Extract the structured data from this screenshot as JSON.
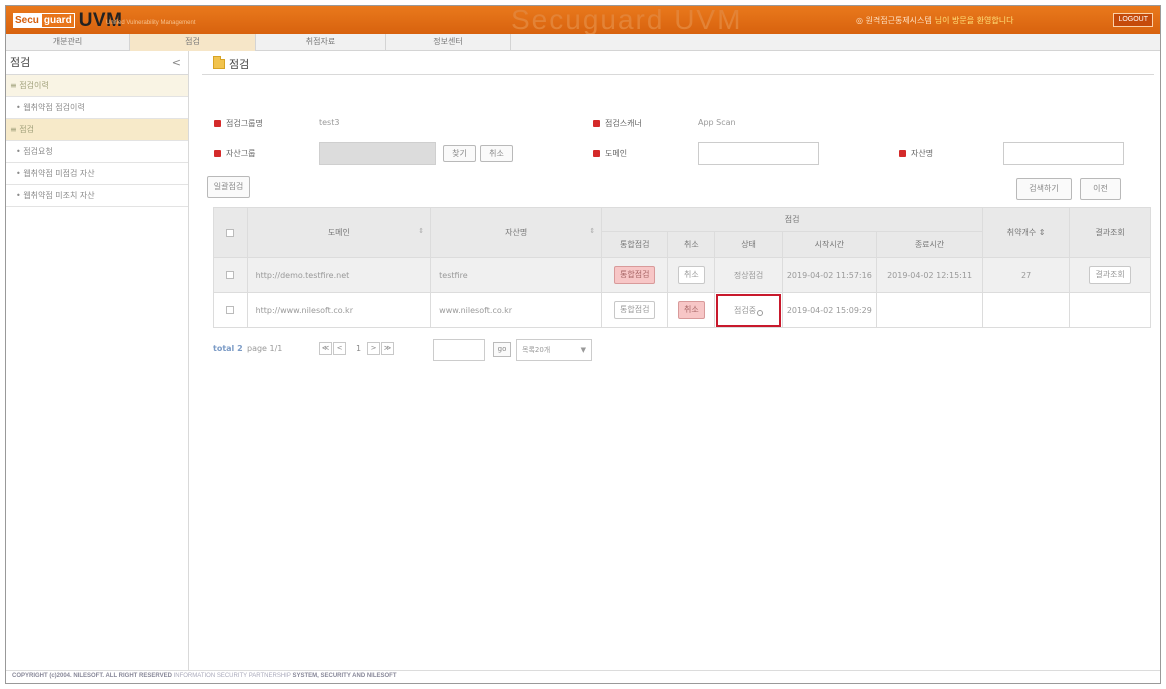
{
  "header": {
    "logo_secu": "Secu",
    "logo_guard": "guard",
    "logo_uvm": "UVM",
    "tagline": "Unified Vulnerability Management",
    "watermark": "Secuguard UVM",
    "notice_text": "◎ 원격접근통제시스템",
    "welcome_text": "님이 방문을 환영합니다",
    "logout_label": "LOGOUT",
    "colors": {
      "header_bg": "#e0691a",
      "nav_active": "#f6e6c8",
      "highlight": "#c8192c",
      "label_bullet": "#d42a2a"
    }
  },
  "nav": {
    "tabs": [
      {
        "label": "개분관리"
      },
      {
        "label": "점검"
      },
      {
        "label": "취점자료"
      },
      {
        "label": "정보센터"
      }
    ],
    "active_index": 1
  },
  "sidebar": {
    "title": "점검",
    "collapse_icon": "chevron-left-icon",
    "collapse_glyph": "<",
    "items": [
      {
        "label": "≡ 점검이력"
      },
      {
        "label": "• 웹취약점 점검이력"
      },
      {
        "label": "≡ 점검"
      },
      {
        "label": "• 점검요청"
      },
      {
        "label": "• 웹취약점 미점검 자산"
      },
      {
        "label": "• 웹취약점 미조치 자산"
      }
    ]
  },
  "page": {
    "title": "점검",
    "folder_icon": "folder-icon"
  },
  "form": {
    "group_name_label": "점검그룹명",
    "group_name_value": "test3",
    "scanner_label": "점검스캐너",
    "scanner_value": "App Scan",
    "asset_group_label": "자산그룹",
    "asset_group_value": "",
    "find_button": "찾기",
    "cancel_button": "취소",
    "domain_label": "도메인",
    "domain_value": "",
    "asset_name_label": "자산명",
    "asset_name_value": "",
    "bulk_check_button": "일괄점검",
    "search_button": "검색하기",
    "reset_button": "이전"
  },
  "table": {
    "headers": {
      "domain": "도메인",
      "asset_name": "자산명",
      "check_group": "점검",
      "request_check": "통합점검",
      "cancel": "취소",
      "status": "상태",
      "start_time": "시작시간",
      "end_time": "종료시간",
      "vuln_count": "취약개수",
      "result_view": "결과조회"
    },
    "sort_icon": "sort-icon",
    "rows": [
      {
        "domain": "http://demo.testfire.net",
        "asset_name": "testfire",
        "check_button": "통합점검",
        "cancel_button": "취소",
        "status": "정상점검",
        "start_time": "2019-04-02 11:57:16",
        "end_time": "2019-04-02 12:15:11",
        "vuln_count": "27",
        "result_button": "결과조회"
      },
      {
        "domain": "http://www.nilesoft.co.kr",
        "asset_name": "www.nilesoft.co.kr",
        "check_button": "통합점검",
        "cancel_button": "취소",
        "status": "점검중",
        "start_time": "2019-04-02 15:09:29",
        "end_time": "",
        "vuln_count": "",
        "result_button": ""
      }
    ]
  },
  "pager": {
    "total_label": "total 2",
    "page_label": "page 1/1",
    "first_glyph": "≪",
    "prev_glyph": "<",
    "current_page": "1",
    "next_glyph": ">",
    "last_glyph": "≫",
    "go_label": "go",
    "page_size_option": "목록20개",
    "page_size_arrow": "▼"
  },
  "footer": {
    "copyright": "COPYRIGHT (c)2004. NILESOFT. ALL RIGHT RESERVED",
    "slogan": "INFORMATION SECURITY PARTNERSHIP",
    "brand": "SYSTEM, SECURITY AND NILESOFT"
  }
}
